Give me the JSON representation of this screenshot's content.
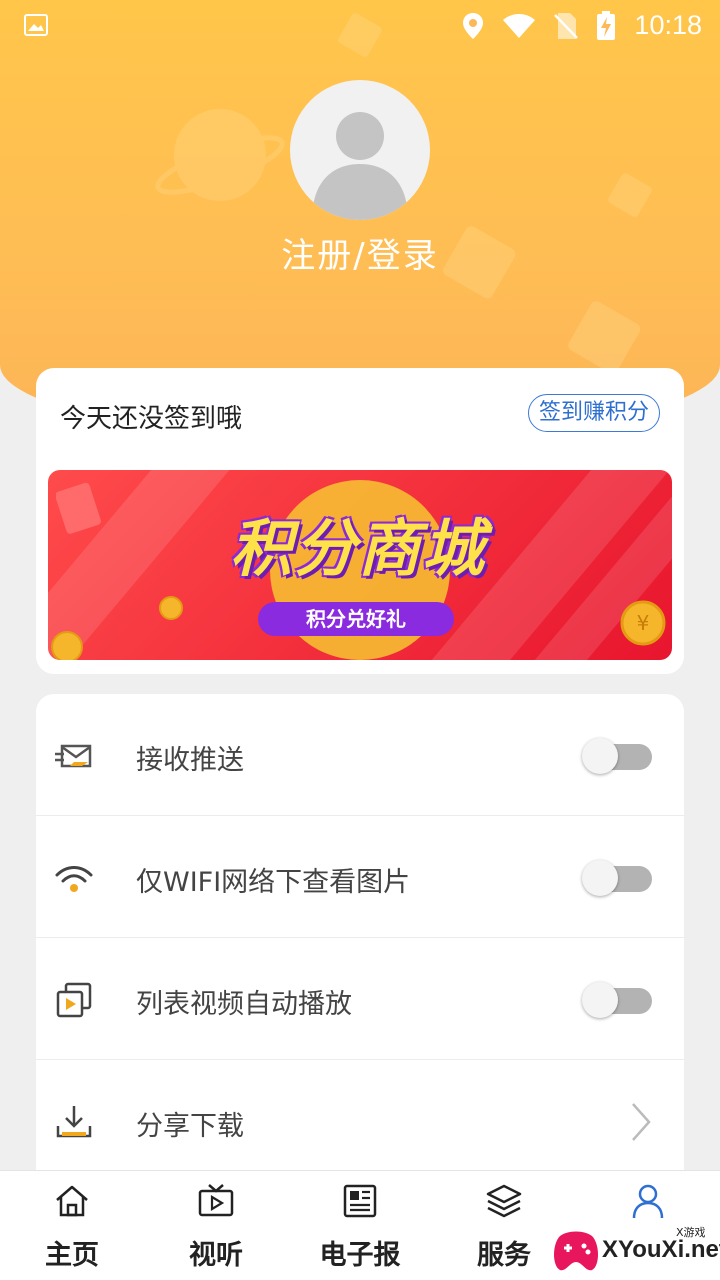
{
  "status_bar": {
    "time": "10:18"
  },
  "profile": {
    "login_text": "注册/登录"
  },
  "checkin": {
    "message": "今天还没签到哦",
    "button_label": "签到赚积分",
    "banner_title": "积分商城",
    "banner_subtitle": "积分兑好礼"
  },
  "settings": {
    "items": [
      {
        "label": "接收推送",
        "icon": "envelope-icon",
        "control": "toggle",
        "on": false
      },
      {
        "label": "仅WIFI网络下查看图片",
        "icon": "wifi-icon",
        "control": "toggle",
        "on": false
      },
      {
        "label": "列表视频自动播放",
        "icon": "video-copy-icon",
        "control": "toggle",
        "on": false
      },
      {
        "label": "分享下载",
        "icon": "download-icon",
        "control": "chevron"
      }
    ]
  },
  "tabbar": {
    "tabs": [
      {
        "label": "主页",
        "icon": "home-icon"
      },
      {
        "label": "视听",
        "icon": "tv-play-icon"
      },
      {
        "label": "电子报",
        "icon": "newspaper-icon"
      },
      {
        "label": "服务",
        "icon": "layers-icon"
      },
      {
        "label": "",
        "icon": "person-icon",
        "active": true
      }
    ]
  },
  "watermark": {
    "text": "XYouXi.net",
    "small": "X游戏"
  },
  "colors": {
    "header": "#ffc64a",
    "accent_blue": "#2f6fd1",
    "icon_gold": "#f0a81e",
    "active_tab": "#2f6fd1"
  }
}
